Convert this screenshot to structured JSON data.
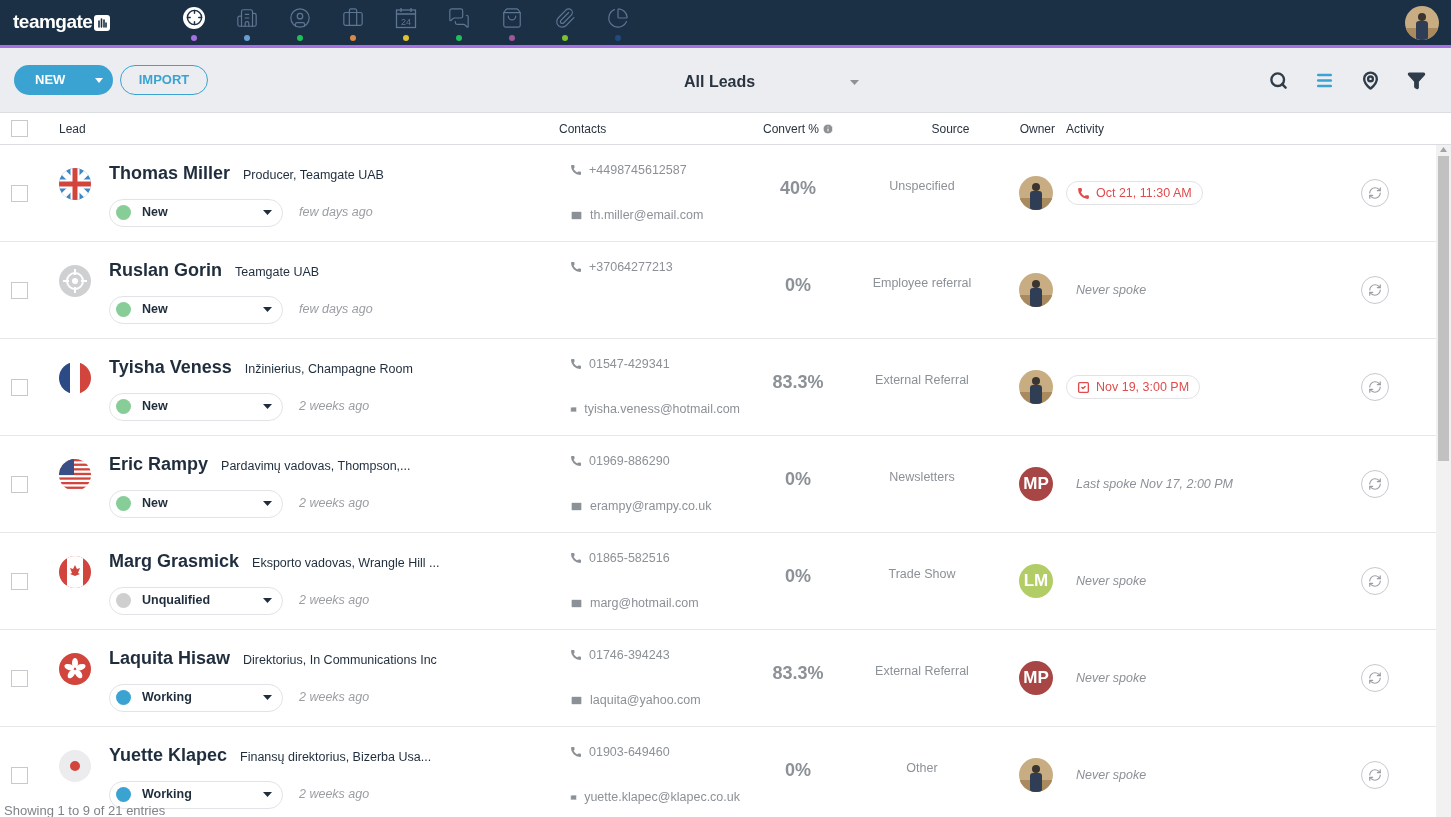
{
  "app": {
    "logo": "teamgate"
  },
  "nav": [
    {
      "kind": "target",
      "selected": true,
      "color": "#a86ee6"
    },
    {
      "kind": "building",
      "selected": false,
      "color": "#6a9fd4"
    },
    {
      "kind": "person",
      "selected": false,
      "color": "#1fbf5a"
    },
    {
      "kind": "briefcase",
      "selected": false,
      "color": "#d98a45"
    },
    {
      "kind": "calendar",
      "selected": false,
      "color": "#e2c12f",
      "text": "24"
    },
    {
      "kind": "chat",
      "selected": false,
      "color": "#1fbf5a"
    },
    {
      "kind": "bag",
      "selected": false,
      "color": "#a0569a"
    },
    {
      "kind": "clip",
      "selected": false,
      "color": "#7cc22a"
    },
    {
      "kind": "pie",
      "selected": false,
      "color": "#1f4a80"
    }
  ],
  "toolbar": {
    "new_button": "NEW",
    "import_button": "IMPORT",
    "view_select": "All Leads",
    "views": [
      {
        "kind": "list",
        "selected": true
      },
      {
        "kind": "map",
        "selected": false
      }
    ]
  },
  "table": {
    "select_all_checked": false,
    "columns": [
      "Lead",
      "Contacts",
      "Convert %",
      "Source",
      "Owner",
      "Activity"
    ],
    "rows": [
      {
        "checked": false,
        "flag": {
          "kind": "uk"
        },
        "name": "Thomas Miller",
        "title": "Producer, Teamgate UAB",
        "status": {
          "label": "New",
          "color": "#86cd98"
        },
        "time": "few days ago",
        "phone": "+4498745612587",
        "email": "th.miller@email.com",
        "convert": "40%",
        "source": "Unspecified",
        "owner": {
          "kind": "photo"
        },
        "activity": {
          "kind": "call",
          "text": "Oct 21, 11:30 AM"
        }
      },
      {
        "checked": false,
        "flag": {
          "kind": "target"
        },
        "name": "Ruslan Gorin",
        "title": "Teamgate UAB",
        "status": {
          "label": "New",
          "color": "#86cd98"
        },
        "time": "few days ago",
        "phone": "+37064277213",
        "convert": "0%",
        "source": "Employee referral",
        "owner": {
          "kind": "photo"
        },
        "activity": {
          "kind": "note",
          "text": "Never spoke"
        }
      },
      {
        "checked": false,
        "flag": {
          "kind": "fr"
        },
        "name": "Tyisha Veness",
        "title": "Inžinierius, Champagne Room",
        "status": {
          "label": "New",
          "color": "#86cd98"
        },
        "time": "2 weeks ago",
        "phone": "01547-429341",
        "email": "tyisha.veness@hotmail.com",
        "convert": "83.3%",
        "source": "External Referral",
        "owner": {
          "kind": "photo"
        },
        "activity": {
          "kind": "task",
          "text": "Nov 19, 3:00 PM"
        }
      },
      {
        "checked": false,
        "flag": {
          "kind": "us"
        },
        "name": "Eric Rampy",
        "title": "Pardavimų vadovas, Thompson,...",
        "status": {
          "label": "New",
          "color": "#86cd98"
        },
        "time": "2 weeks ago",
        "phone": "01969-886290",
        "email": "erampy@rampy.co.uk",
        "convert": "0%",
        "source": "Newsletters",
        "owner": {
          "kind": "initials",
          "text": "MP",
          "color": "#a84646"
        },
        "activity": {
          "kind": "note",
          "text": "Last spoke Nov 17, 2:00 PM"
        }
      },
      {
        "checked": false,
        "flag": {
          "kind": "ca"
        },
        "name": "Marg Grasmick",
        "title": "Eksporto vadovas, Wrangle Hill ...",
        "status": {
          "label": "Unqualified",
          "color": "#cfcfcf"
        },
        "time": "2 weeks ago",
        "phone": "01865-582516",
        "email": "marg@hotmail.com",
        "convert": "0%",
        "source": "Trade Show",
        "owner": {
          "kind": "initials",
          "text": "LM",
          "color": "#b2cc66"
        },
        "activity": {
          "kind": "note",
          "text": "Never spoke"
        }
      },
      {
        "checked": false,
        "flag": {
          "kind": "hk"
        },
        "name": "Laquita Hisaw",
        "title": "Direktorius, In Communications Inc",
        "status": {
          "label": "Working",
          "color": "#3aa3d1"
        },
        "time": "2 weeks ago",
        "phone": "01746-394243",
        "email": "laquita@yahoo.com",
        "convert": "83.3%",
        "source": "External Referral",
        "owner": {
          "kind": "initials",
          "text": "MP",
          "color": "#a84646"
        },
        "activity": {
          "kind": "note",
          "text": "Never spoke"
        }
      },
      {
        "checked": false,
        "flag": {
          "kind": "jp"
        },
        "name": "Yuette Klapec",
        "title": "Finansų direktorius, Bizerba Usa...",
        "status": {
          "label": "Working",
          "color": "#3aa3d1"
        },
        "time": "2 weeks ago",
        "phone": "01903-649460",
        "email": "yuette.klapec@klapec.co.uk",
        "convert": "0%",
        "source": "Other",
        "owner": {
          "kind": "photo"
        },
        "activity": {
          "kind": "note",
          "text": "Never spoke"
        }
      }
    ]
  },
  "footer": {
    "text": "Showing 1 to 9 of 21 entries"
  }
}
